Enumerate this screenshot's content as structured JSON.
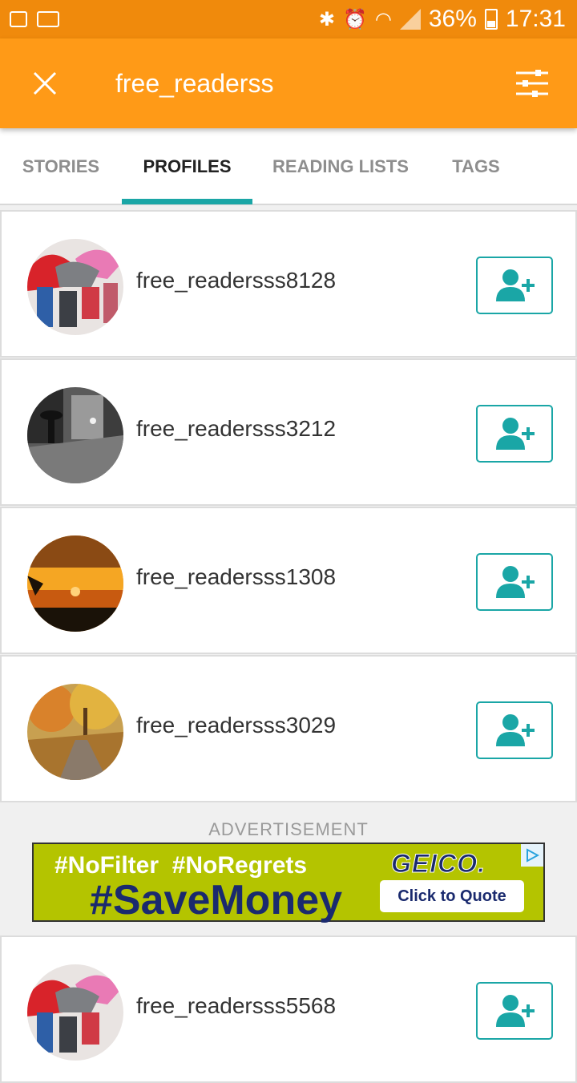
{
  "status_bar": {
    "battery": "36%",
    "time": "17:31"
  },
  "toolbar": {
    "title": "free_readerss"
  },
  "tabs": [
    {
      "label": "STORIES"
    },
    {
      "label": "PROFILES",
      "active": true
    },
    {
      "label": "READING LISTS"
    },
    {
      "label": "TAGS"
    }
  ],
  "profiles": [
    {
      "username": "free_readersss8128"
    },
    {
      "username": "free_readersss3212"
    },
    {
      "username": "free_readersss1308"
    },
    {
      "username": "free_readersss3029"
    },
    {
      "username": "free_readersss5568"
    }
  ],
  "advertisement": {
    "label": "ADVERTISEMENT",
    "headline1": "#NoFilter  #NoRegrets",
    "headline2": "#SaveMoney",
    "brand": "GEICO.",
    "cta": "Click to Quote"
  },
  "colors": {
    "status_bar": "#f08a0c",
    "toolbar": "#ff9a17",
    "accent": "#1aa6a6"
  }
}
